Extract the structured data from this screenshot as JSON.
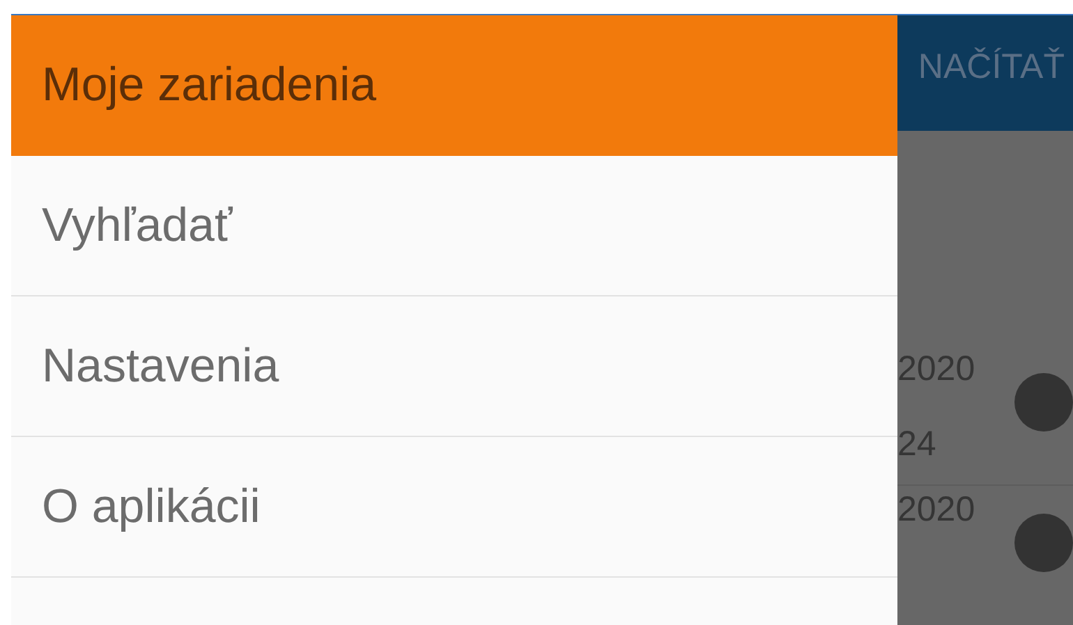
{
  "app_bar": {
    "action": "NAČÍTAŤ"
  },
  "list_rows": [
    {
      "line_1": "2020",
      "line_2": "24"
    },
    {
      "line_1": "2020"
    }
  ],
  "drawer": {
    "items": [
      {
        "label": "Moje zariadenia",
        "selected": true
      },
      {
        "label": "Vyhľadať",
        "selected": false
      },
      {
        "label": "Nastavenia",
        "selected": false
      },
      {
        "label": "O aplikácii",
        "selected": false
      }
    ]
  }
}
